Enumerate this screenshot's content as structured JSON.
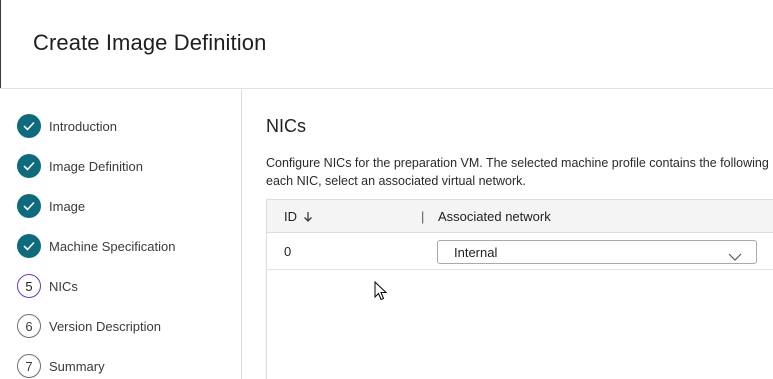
{
  "header": {
    "title": "Create Image Definition"
  },
  "steps": [
    {
      "label": "Introduction",
      "state": "done",
      "marker": "check-icon"
    },
    {
      "label": "Image Definition",
      "state": "done",
      "marker": "check-icon"
    },
    {
      "label": "Image",
      "state": "done",
      "marker": "check-icon"
    },
    {
      "label": "Machine Specification",
      "state": "done",
      "marker": "check-icon"
    },
    {
      "label": "NICs",
      "state": "current",
      "number": "5"
    },
    {
      "label": "Version Description",
      "state": "todo",
      "number": "6"
    },
    {
      "label": "Summary",
      "state": "todo",
      "number": "7"
    }
  ],
  "main": {
    "title": "NICs",
    "description_line1": "Configure NICs for the preparation VM. The selected machine profile contains the following",
    "description_line2": "each NIC, select an associated virtual network."
  },
  "table": {
    "columns": {
      "id": "ID",
      "separator": "|",
      "network": "Associated network"
    },
    "sort_icon": "arrow-down-icon",
    "rows": [
      {
        "id": "0",
        "network": "Internal"
      }
    ]
  },
  "colors": {
    "done_step": "#0e6b7d",
    "current_step_ring": "#6a35c9",
    "todo_step_ring": "#6d6d6d",
    "header_bg": "#f4f4f4"
  }
}
